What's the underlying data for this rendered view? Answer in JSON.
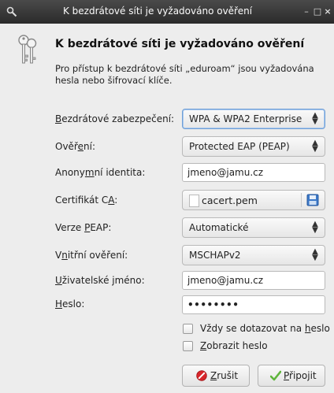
{
  "window": {
    "title": "K bezdrátové síti je vyžadováno ověření",
    "minimize": "–",
    "maximize": "□",
    "close": "×"
  },
  "header": {
    "title": "K bezdrátové síti je vyžadováno ověření",
    "description": "Pro přístup k bezdrátové síti „eduroam“ jsou vyžadována hesla nebo šifrovací klíče."
  },
  "form": {
    "security": {
      "label_pre": "",
      "label_u": "B",
      "label_post": "ezdrátové zabezpečení:",
      "value": "WPA & WPA2 Enterprise"
    },
    "auth": {
      "label_pre": "Ověř",
      "label_u": "e",
      "label_post": "ní:",
      "value": "Protected EAP (PEAP)"
    },
    "anon": {
      "label_pre": "Anony",
      "label_u": "m",
      "label_post": "ní identita:",
      "value": "jmeno@jamu.cz"
    },
    "ca": {
      "label_pre": "Certifikát C",
      "label_u": "A",
      "label_post": ":",
      "value": "cacert.pem"
    },
    "peap": {
      "label_pre": "Verze ",
      "label_u": "P",
      "label_post": "EAP:",
      "value": "Automatické"
    },
    "inner": {
      "label_pre": "V",
      "label_u": "n",
      "label_post": "itřní ověření:",
      "value": "MSCHAPv2"
    },
    "user": {
      "label_pre": "",
      "label_u": "U",
      "label_post": "živatelské jméno:",
      "value": "jmeno@jamu.cz"
    },
    "password": {
      "label_pre": "",
      "label_u": "H",
      "label_post": "eslo:",
      "value": "••••••••"
    },
    "always_ask": {
      "label_pre": "Vždy se dotazovat na ",
      "label_u": "h",
      "label_post": "eslo"
    },
    "show_password": {
      "label_pre": "",
      "label_u": "Z",
      "label_post": "obrazit heslo"
    }
  },
  "buttons": {
    "cancel": {
      "pre": "",
      "u": "Z",
      "post": "rušit"
    },
    "connect": {
      "pre": "",
      "u": "P",
      "post": "řipojit"
    }
  },
  "colors": {
    "titlebar": "#333333",
    "accent": "#6f9fd6",
    "cancel_icon": "#d8262b",
    "connect_icon": "#5fb53c"
  }
}
